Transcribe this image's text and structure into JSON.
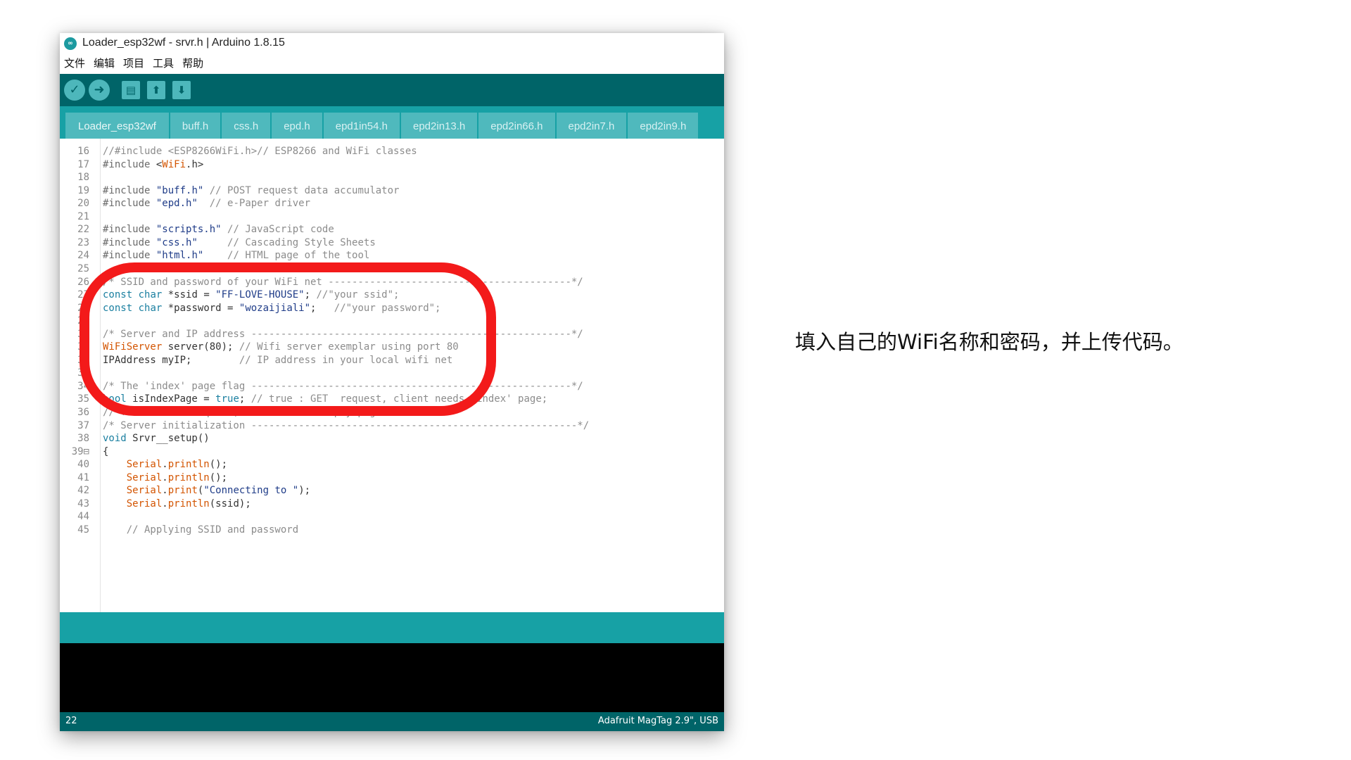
{
  "window": {
    "title": "Loader_esp32wf - srvr.h | Arduino 1.8.15",
    "logo": "arduino-logo-icon"
  },
  "menu": [
    "文件",
    "编辑",
    "项目",
    "工具",
    "帮助"
  ],
  "toolbar": {
    "verify": {
      "icon": "check-icon",
      "glyph": "✓"
    },
    "upload": {
      "icon": "arrow-right-icon",
      "glyph": "➜"
    },
    "new": {
      "icon": "new-file-icon",
      "glyph": "▤"
    },
    "open": {
      "icon": "arrow-up-icon",
      "glyph": "⬆"
    },
    "save": {
      "icon": "arrow-down-icon",
      "glyph": "⬇"
    }
  },
  "tabs": [
    "Loader_esp32wf",
    "buff.h",
    "css.h",
    "epd.h",
    "epd1in54.h",
    "epd2in13.h",
    "epd2in66.h",
    "epd2in7.h",
    "epd2in9.h"
  ],
  "code_lines": [
    {
      "n": "16",
      "t": "//#include <ESP8266WiFi.h>// ESP8266 and WiFi classes"
    },
    {
      "n": "17",
      "t": "#include <WiFi.h>"
    },
    {
      "n": "18",
      "t": ""
    },
    {
      "n": "19",
      "t": "#include \"buff.h\" // POST request data accumulator"
    },
    {
      "n": "20",
      "t": "#include \"epd.h\"  // e-Paper driver"
    },
    {
      "n": "21",
      "t": ""
    },
    {
      "n": "22",
      "t": "#include \"scripts.h\" // JavaScript code"
    },
    {
      "n": "23",
      "t": "#include \"css.h\"     // Cascading Style Sheets"
    },
    {
      "n": "24",
      "t": "#include \"html.h\"    // HTML page of the tool"
    },
    {
      "n": "25",
      "t": ""
    },
    {
      "n": "26",
      "t": "/* SSID and password of your WiFi net -----------------------------------------*/"
    },
    {
      "n": "27",
      "t": "const char *ssid = \"FF-LOVE-HOUSE\"; //\"your ssid\";"
    },
    {
      "n": "28",
      "t": "const char *password = \"wozaijiali\";   //\"your password\";"
    },
    {
      "n": "29",
      "t": ""
    },
    {
      "n": "30",
      "t": "/* Server and IP address ------------------------------------------------------*/"
    },
    {
      "n": "31",
      "t": "WiFiServer server(80); // Wifi server exemplar using port 80"
    },
    {
      "n": "32",
      "t": "IPAddress myIP;        // IP address in your local wifi net"
    },
    {
      "n": "33",
      "t": ""
    },
    {
      "n": "34",
      "t": "/* The 'index' page flag ------------------------------------------------------*/"
    },
    {
      "n": "35",
      "t": "bool isIndexPage = true; // true : GET  request, client needs 'index' page;"
    },
    {
      "n": "36",
      "t": "// false: POST request, server sends empty page."
    },
    {
      "n": "37",
      "t": "/* Server initialization -------------------------------------------------------*/"
    },
    {
      "n": "38",
      "t": "void Srvr__setup()"
    },
    {
      "n": "39⊟",
      "t": "{"
    },
    {
      "n": "40",
      "t": "    Serial.println();"
    },
    {
      "n": "41",
      "t": "    Serial.println();"
    },
    {
      "n": "42",
      "t": "    Serial.print(\"Connecting to \");"
    },
    {
      "n": "43",
      "t": "    Serial.println(ssid);"
    },
    {
      "n": "44",
      "t": ""
    },
    {
      "n": "45",
      "t": "    // Applying SSID and password"
    }
  ],
  "status": {
    "line": "22",
    "board": "Adafruit MagTag 2.9\", USB"
  },
  "instruction": "填入自己的WiFi名称和密码，并上传代码。",
  "colors": {
    "toolbar_dark_teal": "#006468",
    "tab_strip_teal": "#17a1a5",
    "tab_teal": "#4fb9bd",
    "annotation_red": "#f31a1a"
  }
}
